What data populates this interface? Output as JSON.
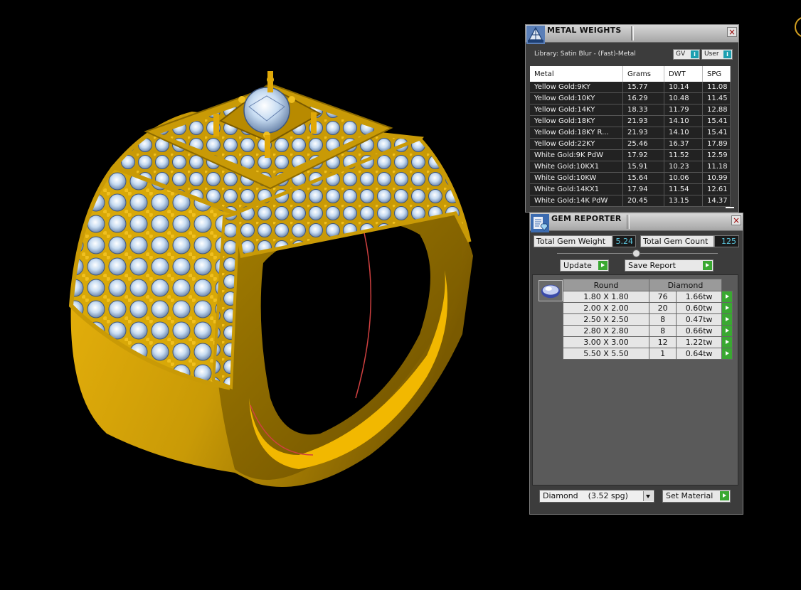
{
  "colors": {
    "background": "#000000",
    "metal_gold": "#c99a06",
    "diamond": "#b8d4ee",
    "panel_bg": "#3c3c3c",
    "value_text": "#5cc8e0",
    "accent_green": "#3aa832"
  },
  "metal_weights": {
    "title": "METAL WEIGHTS",
    "library_label": "Library: Satin Blur - (Fast)-Metal",
    "gv_button": "GV",
    "user_button": "User",
    "info_glyph": "i",
    "columns": [
      "Metal",
      "Grams",
      "DWT",
      "SPG"
    ],
    "rows": [
      {
        "metal": "Yellow Gold:9KY",
        "grams": "15.77",
        "dwt": "10.14",
        "spg": "11.08"
      },
      {
        "metal": "Yellow Gold:10KY",
        "grams": "16.29",
        "dwt": "10.48",
        "spg": "11.45"
      },
      {
        "metal": "Yellow Gold:14KY",
        "grams": "18.33",
        "dwt": "11.79",
        "spg": "12.88"
      },
      {
        "metal": "Yellow Gold:18KY",
        "grams": "21.93",
        "dwt": "14.10",
        "spg": "15.41"
      },
      {
        "metal": "Yellow Gold:18KY R...",
        "grams": "21.93",
        "dwt": "14.10",
        "spg": "15.41"
      },
      {
        "metal": "Yellow Gold:22KY",
        "grams": "25.46",
        "dwt": "16.37",
        "spg": "17.89"
      },
      {
        "metal": "White Gold:9K PdW",
        "grams": "17.92",
        "dwt": "11.52",
        "spg": "12.59"
      },
      {
        "metal": "White Gold:10KX1",
        "grams": "15.91",
        "dwt": "10.23",
        "spg": "11.18"
      },
      {
        "metal": "White Gold:10KW",
        "grams": "15.64",
        "dwt": "10.06",
        "spg": "10.99"
      },
      {
        "metal": "White Gold:14KX1",
        "grams": "17.94",
        "dwt": "11.54",
        "spg": "12.61"
      },
      {
        "metal": "White Gold:14K PdW",
        "grams": "20.45",
        "dwt": "13.15",
        "spg": "14.37"
      }
    ]
  },
  "gem_reporter": {
    "title": "GEM REPORTER",
    "total_weight_label": "Total Gem Weight",
    "total_weight_value": "5.24",
    "total_count_label": "Total Gem Count",
    "total_count_value": "125",
    "update_label": "Update",
    "save_report_label": "Save Report",
    "shape_header": "Round",
    "stone_header": "Diamond",
    "gems": [
      {
        "size": "1.80 X 1.80",
        "count": "76",
        "tw": "1.66tw"
      },
      {
        "size": "2.00 X 2.00",
        "count": "20",
        "tw": "0.60tw"
      },
      {
        "size": "2.50 X 2.50",
        "count": "8",
        "tw": "0.47tw"
      },
      {
        "size": "2.80 X 2.80",
        "count": "8",
        "tw": "0.66tw"
      },
      {
        "size": "3.00 X 3.00",
        "count": "12",
        "tw": "1.22tw"
      },
      {
        "size": "5.50 X 5.50",
        "count": "1",
        "tw": "0.64tw"
      }
    ],
    "material_select": "Diamond    (3.52 spg)",
    "set_material_label": "Set Material"
  }
}
